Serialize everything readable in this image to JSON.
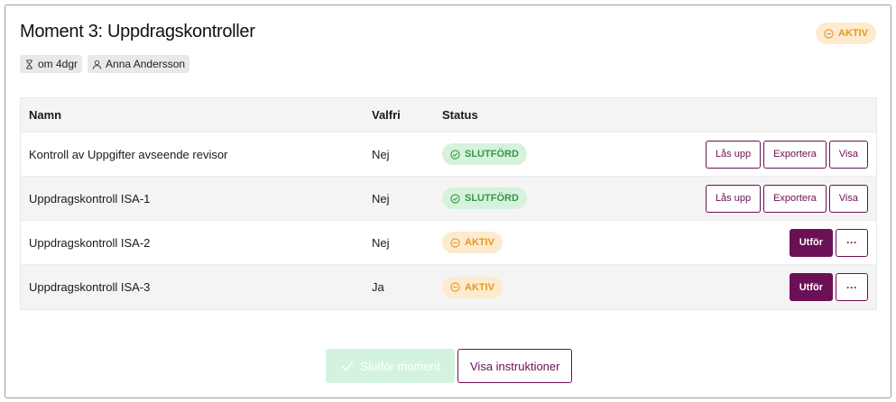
{
  "card": {
    "title": "Moment 3: Uppdragskontroller",
    "status_badge": "AKTIV",
    "meta": {
      "due": "om 4dgr",
      "assignee": "Anna Andersson"
    }
  },
  "table": {
    "columns": {
      "name": "Namn",
      "optional": "Valfri",
      "status": "Status"
    },
    "rows": [
      {
        "name": "Kontroll av Uppgifter avseende revisor",
        "optional": "Nej",
        "status": "SLUTFÖRD"
      },
      {
        "name": "Uppdragskontroll ISA-1",
        "optional": "Nej",
        "status": "SLUTFÖRD"
      },
      {
        "name": "Uppdragskontroll ISA-2",
        "optional": "Nej",
        "status": "AKTIV"
      },
      {
        "name": "Uppdragskontroll ISA-3",
        "optional": "Ja",
        "status": "AKTIV"
      }
    ],
    "actions": {
      "unlock": "Lås upp",
      "export": "Exportera",
      "view": "Visa",
      "perform": "Utför",
      "more": "···"
    }
  },
  "footer": {
    "complete_label": "Slutför moment",
    "instructions_label": "Visa instruktioner"
  },
  "colors": {
    "brand": "#6b1055",
    "done_bg": "#d6f1dc",
    "done_fg": "#2e9c45",
    "active_bg": "#fdebcf",
    "active_fg": "#e8961c"
  },
  "icons": {
    "due": "hourglass-icon",
    "assignee": "user-icon",
    "done": "check-circle-icon",
    "active": "minus-circle-icon",
    "complete": "checkmark-icon"
  }
}
